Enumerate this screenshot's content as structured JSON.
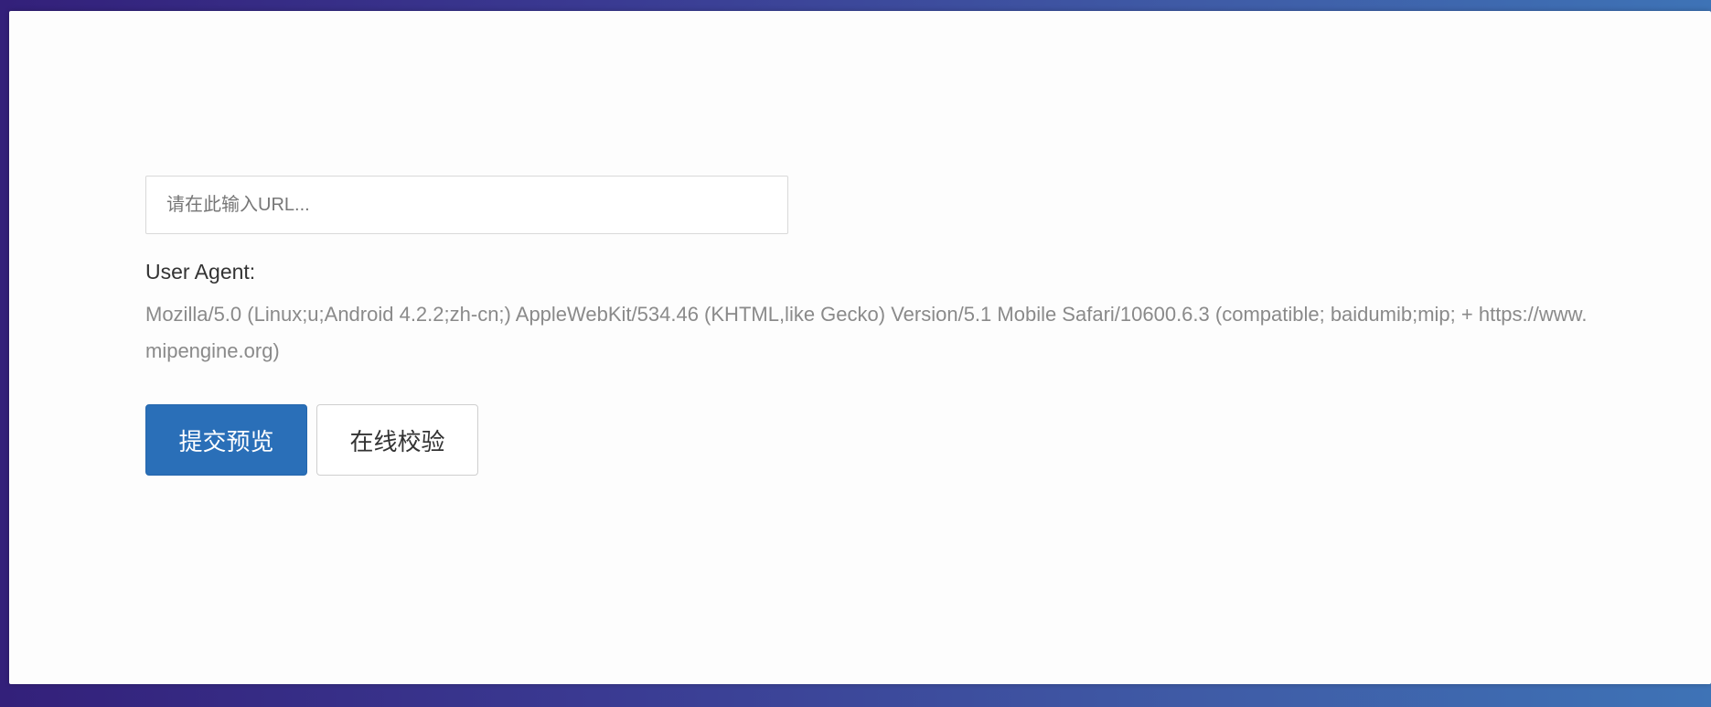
{
  "form": {
    "url_placeholder": "请在此输入URL...",
    "ua_label": "User Agent:",
    "ua_value": "Mozilla/5.0 (Linux;u;Android 4.2.2;zh-cn;) AppleWebKit/534.46 (KHTML,like Gecko) Version/5.1 Mobile Safari/10600.6.3 (compatible; baidumib;mip; + https://www.mipengine.org)"
  },
  "actions": {
    "submit_preview": "提交预览",
    "online_validate": "在线校验"
  },
  "colors": {
    "primary": "#2a6fb8",
    "background_gradient_start": "#33207a",
    "background_gradient_end": "#3e73b6"
  }
}
